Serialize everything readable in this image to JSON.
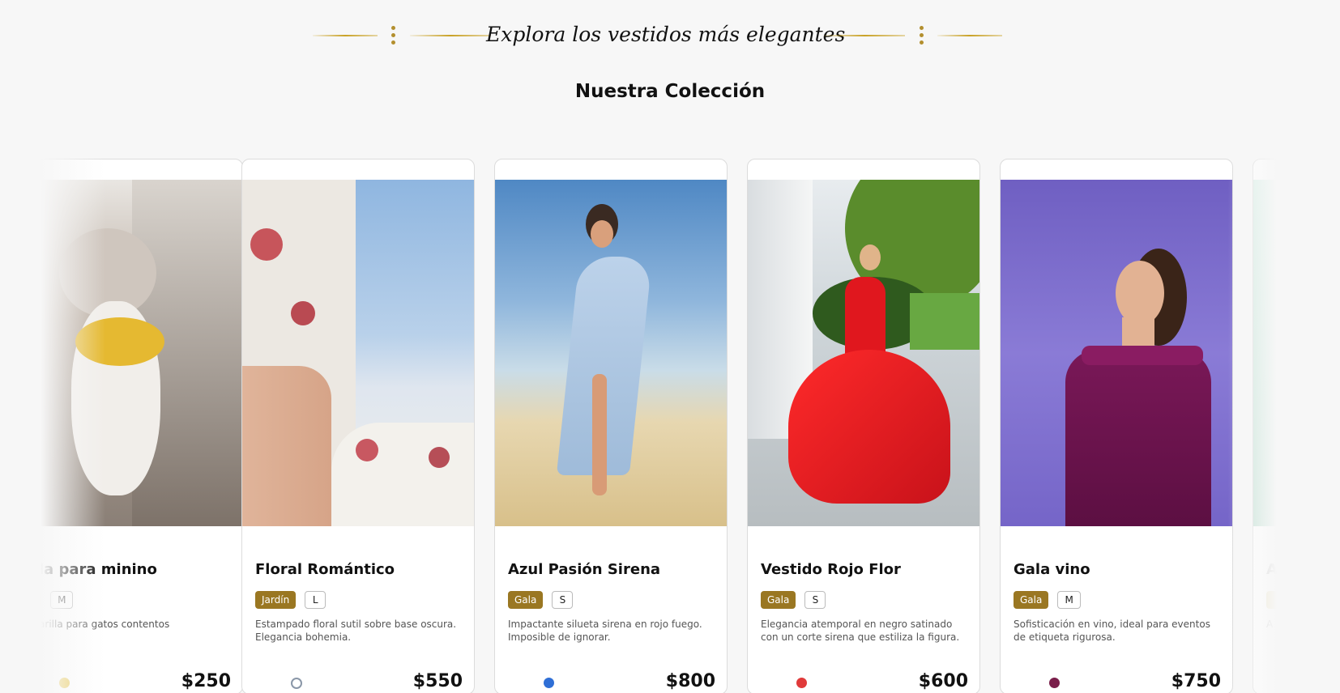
{
  "header": {
    "tagline": "Explora los vestidos más elegantes",
    "accent_color": "#c9a227"
  },
  "section": {
    "title": "Nuestra Colección"
  },
  "products": [
    {
      "name": "ada para minino",
      "category": "",
      "size": "M",
      "description": "amarilla para gatos contentos",
      "price": "$250",
      "color_hex": "#e8c64a",
      "image": "cat-with-yellow-bandana"
    },
    {
      "name": "Floral Romántico",
      "category": "Jardín",
      "size": "L",
      "description": "Estampado floral sutil sobre base oscura. Elegancia bohemia.",
      "price": "$550",
      "color_hex": "#cfd6e0",
      "image": "floral-dress-by-the-sea"
    },
    {
      "name": "Azul Pasión Sirena",
      "category": "Gala",
      "size": "S",
      "description": "Impactante silueta sirena en rojo fuego. Imposible de ignorar.",
      "price": "$800",
      "color_hex": "#2f6fd6",
      "image": "light-blue-dress-on-beach"
    },
    {
      "name": "Vestido Rojo Flor",
      "category": "Gala",
      "size": "S",
      "description": "Elegancia atemporal en negro satinado con un corte sirena que estiliza la figura.",
      "price": "$600",
      "color_hex": "#e03a3a",
      "image": "red-gown-in-garden"
    },
    {
      "name": "Gala vino",
      "category": "Gala",
      "size": "M",
      "description": "Sofisticación en vino, ideal para eventos de etiqueta rigurosa.",
      "price": "$750",
      "color_hex": "#7a1e4a",
      "image": "wine-off-shoulder-gown"
    },
    {
      "name": "A",
      "category": "",
      "size": "",
      "description": "A",
      "price": "",
      "color_hex": "#cfe8dc",
      "image": "partial-card"
    }
  ]
}
